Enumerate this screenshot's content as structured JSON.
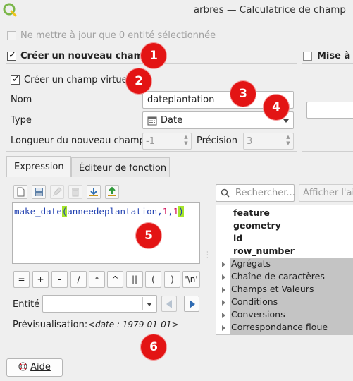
{
  "window": {
    "title": "arbres — Calculatrice de champ"
  },
  "options": {
    "update_selected_label": "Ne mettre à jour que 0 entité sélectionnée",
    "create_new_field_label": "Créer un nouveau champ",
    "update_existing_label": "Mise à jo",
    "create_virtual_label": "Créer un champ virtuel"
  },
  "new_field": {
    "name_label": "Nom",
    "name_value": "dateplantation",
    "type_label": "Type",
    "type_value": "Date",
    "length_label": "Longueur du nouveau champ",
    "length_value": "-1",
    "precision_label": "Précision",
    "precision_value": "3"
  },
  "tabs": [
    {
      "label": "Expression"
    },
    {
      "label": "Éditeur de fonction"
    }
  ],
  "expression": {
    "func": "make_date",
    "open_paren": "(",
    "field": "anneedeplantation",
    "comma1": ",",
    "arg1": "1",
    "comma2": ",",
    "arg2": "1",
    "close_paren": ")"
  },
  "operators": [
    "=",
    "+",
    "-",
    "/",
    "*",
    "^",
    "||",
    "(",
    ")",
    "'\\n'"
  ],
  "feature": {
    "label": "Entité",
    "value": ""
  },
  "preview": {
    "label": "Prévisualisation:",
    "value": "<date : 1979-01-01>"
  },
  "search": {
    "placeholder": "Rechercher...",
    "help_button": "Afficher l'aid"
  },
  "function_tree": {
    "fields": [
      "feature",
      "geometry",
      "id",
      "row_number"
    ],
    "groups": [
      "Agrégats",
      "Chaîne de caractères",
      "Champs et Valeurs",
      "Conditions",
      "Conversions",
      "Correspondance floue"
    ]
  },
  "help_button": {
    "label": "Aide"
  },
  "badges": [
    "1",
    "2",
    "3",
    "4",
    "5",
    "6"
  ],
  "colors": {
    "badge": "#e31414",
    "highlight": "#a6e52a",
    "group_bg": "#c4c4c4",
    "expression_text": "#1f3fb0",
    "number_text": "#d4145a"
  }
}
